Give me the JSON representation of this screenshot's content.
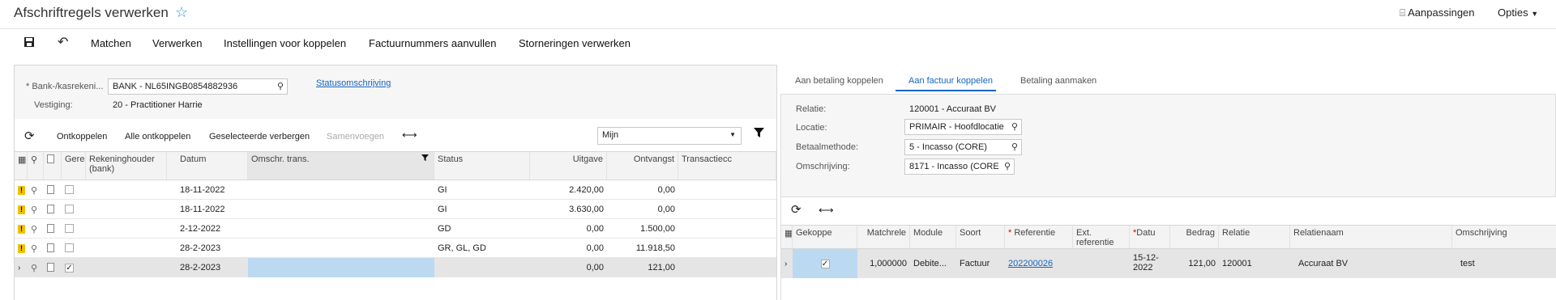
{
  "header": {
    "title": "Afschriftregels verwerken",
    "customize": "Aanpassingen",
    "options": "Opties"
  },
  "toolbar": {
    "match": "Matchen",
    "process": "Verwerken",
    "match_settings": "Instellingen voor koppelen",
    "fill_invoice_numbers": "Factuurnummers aanvullen",
    "process_reversals": "Storneringen verwerken"
  },
  "left": {
    "bank_label": "* Bank-/kasrekeni...",
    "bank_value": "BANK - NL65INGB0854882936",
    "branch_label": "Vestiging:",
    "branch_value": "20 - Practitioner Harrie",
    "status_link": "Statusomschrijving",
    "actions": {
      "unlink": "Ontkoppelen",
      "unlink_all": "Alle ontkoppelen",
      "hide_selected": "Geselecteerde verbergen",
      "merge": "Samenvoegen"
    },
    "filter_select": "Mijn",
    "columns": {
      "processed": "Gere",
      "account_holder": "Rekeninghouder (bank)",
      "date": "Datum",
      "description": "Omschr. trans.",
      "status": "Status",
      "expense": "Uitgave",
      "received": "Ontvangst",
      "transaction": "Transactiecc"
    },
    "rows": [
      {
        "date": "18-11-2022",
        "status": "GI",
        "expense": "2.420,00",
        "received": "0,00",
        "warn": true,
        "checked": false
      },
      {
        "date": "18-11-2022",
        "status": "GI",
        "expense": "3.630,00",
        "received": "0,00",
        "warn": true,
        "checked": false
      },
      {
        "date": "2-12-2022",
        "status": "GD",
        "expense": "0,00",
        "received": "1.500,00",
        "warn": true,
        "checked": false
      },
      {
        "date": "28-2-2023",
        "status": "GR, GL, GD",
        "expense": "0,00",
        "received": "11.918,50",
        "warn": true,
        "checked": false
      },
      {
        "date": "28-2-2023",
        "status": "",
        "expense": "0,00",
        "received": "121,00",
        "warn": false,
        "checked": true,
        "selected": true
      }
    ]
  },
  "right": {
    "tabs": [
      "Aan betaling koppelen",
      "Aan factuur koppelen",
      "Betaling aanmaken"
    ],
    "relation_label": "Relatie:",
    "relation_value": "120001 - Accuraat BV",
    "location_label": "Locatie:",
    "location_value": "PRIMAIR - Hoofdlocatie",
    "method_label": "Betaalmethode:",
    "method_value": "5 - Incasso (CORE)",
    "desc_label": "Omschrijving:",
    "desc_value": "8171 - Incasso (CORE",
    "columns": {
      "linked": "Gekoppe",
      "match": "Matchrele",
      "module": "Module",
      "type": "Soort",
      "reference": "Referentie",
      "ext_ref": "Ext. referentie",
      "date": "Datu",
      "amount": "Bedrag",
      "relation": "Relatie",
      "relation_name": "Relatienaam",
      "description": "Omschrijving"
    },
    "rows": [
      {
        "match": "1,000000",
        "module": "Debite...",
        "type": "Factuur",
        "reference": "202200026",
        "date": "15-12-2022",
        "amount": "121,00",
        "relation": "120001",
        "relation_name": "Accuraat BV",
        "description": "test",
        "checked": true
      }
    ]
  },
  "colors": {
    "accent": "#1565c0",
    "selected_row": "#e5e5e5",
    "selected_cell": "#bcd9f2",
    "warning": "#f0c000"
  }
}
